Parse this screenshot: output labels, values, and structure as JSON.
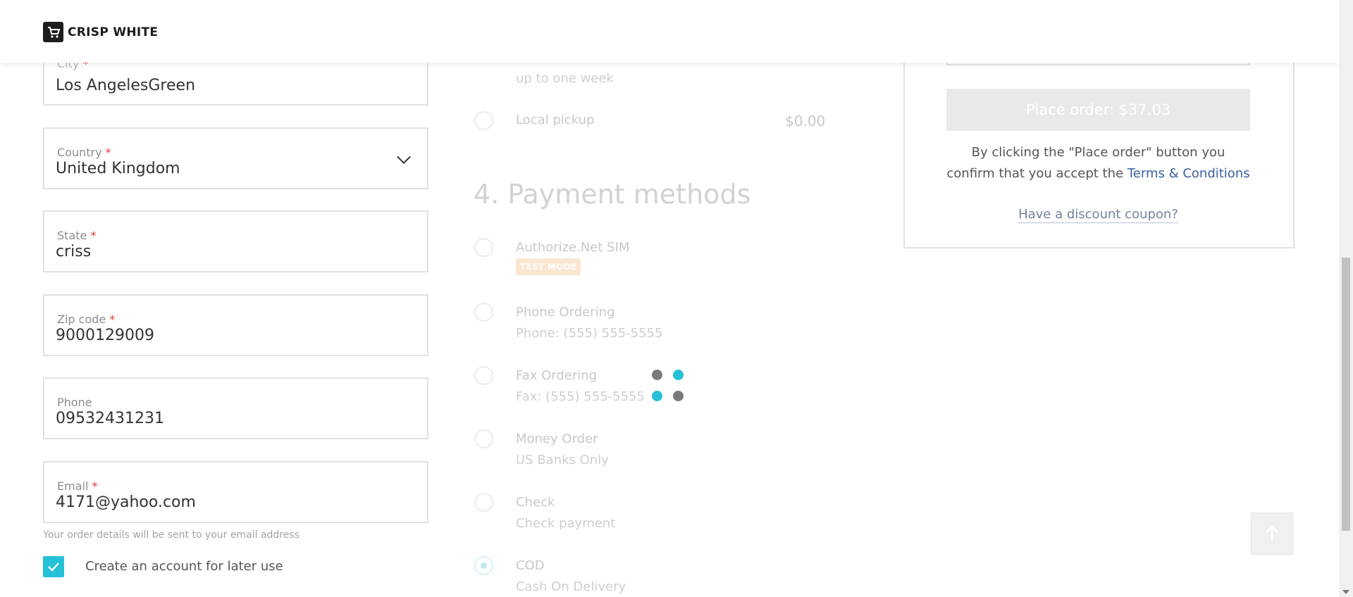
{
  "header": {
    "brand": "CRISP WHITE"
  },
  "form": {
    "city": {
      "label": "City",
      "value": "Los AngelesGreen"
    },
    "country": {
      "label": "Country",
      "value": "United Kingdom"
    },
    "state": {
      "label": "State",
      "value": "criss"
    },
    "zip": {
      "label": "Zip code",
      "value": "9000129009"
    },
    "phone": {
      "label": "Phone",
      "value": "09532431231"
    },
    "email": {
      "label": "Email",
      "value": "4171@yahoo.com"
    },
    "required_mark": "*",
    "email_hint": "Your order details will be sent to your email address",
    "create_account": {
      "label": "Create an account for later use",
      "checked": true
    }
  },
  "shipping": {
    "partial_sub": "up to one week",
    "local_pickup": {
      "label": "Local pickup",
      "price": "$0.00"
    }
  },
  "payment": {
    "section_title": "4.  Payment methods",
    "methods": [
      {
        "title": "Authorize.Net SIM",
        "badge": "TEST MODE"
      },
      {
        "title": "Phone Ordering",
        "sub": "Phone: (555) 555-5555"
      },
      {
        "title": "Fax Ordering",
        "sub": "Fax: (555) 555-5555"
      },
      {
        "title": "Money Order",
        "sub": "US Banks Only"
      },
      {
        "title": "Check",
        "sub": "Check payment"
      },
      {
        "title": "COD",
        "sub": "Cash On Delivery",
        "selected": true
      }
    ]
  },
  "summary": {
    "place_order": "Place order: $37.03",
    "confirm_text": "By clicking the \"Place order\" button you confirm that you accept the",
    "terms": "Terms & Conditions",
    "coupon": "Have a discount coupon?"
  },
  "colors": {
    "accent": "#26c0d9",
    "required": "#e53935",
    "link": "#3a5f9f"
  },
  "icons": {
    "checkbox": "checkmark-icon",
    "scroll_top": "arrow-up-icon",
    "select": "chevron-down-icon"
  }
}
